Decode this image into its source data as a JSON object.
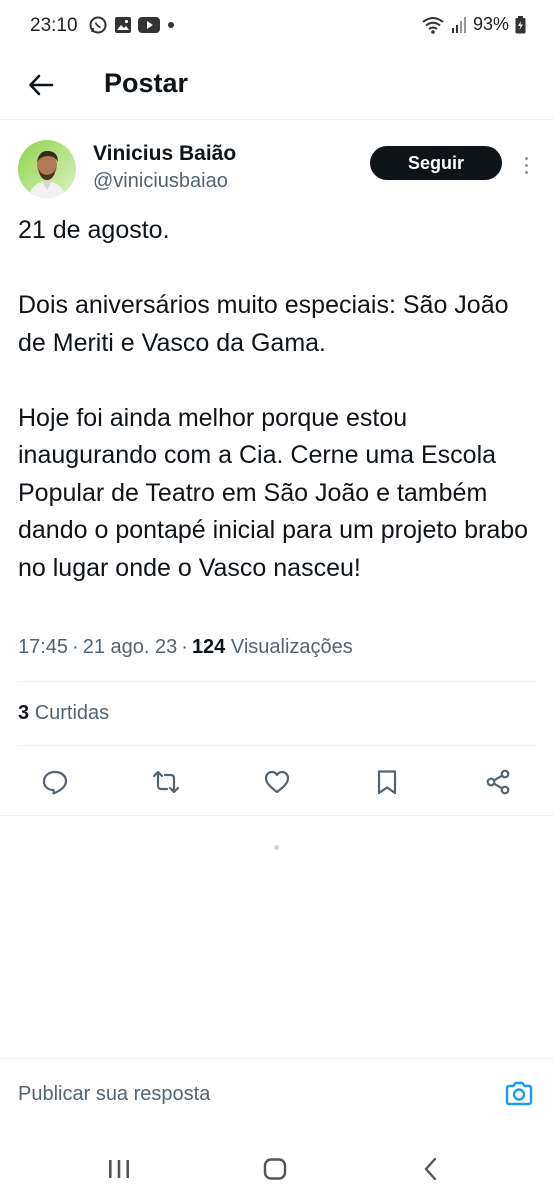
{
  "status_bar": {
    "time": "23:10",
    "battery": "93%",
    "left_icons": [
      "whatsapp-icon",
      "gallery-icon",
      "youtube-icon",
      "dot-icon"
    ],
    "right_icons": [
      "wifi-icon",
      "signal-icon",
      "battery-icon"
    ]
  },
  "header": {
    "title": "Postar",
    "back_icon": "arrow-left-icon"
  },
  "author": {
    "name": "Vinicius Baião",
    "handle": "@viniciusbaiao",
    "follow_label": "Seguir"
  },
  "tweet": {
    "paragraphs": [
      "21 de agosto.",
      "Dois aniversários muito especiais: São João de Meriti e Vasco da Gama.",
      "Hoje foi ainda melhor porque estou inaugurando com a Cia. Cerne uma Escola Popular de Teatro em São João e também dando o pontapé inicial para um projeto brabo no lugar onde o Vasco nasceu!"
    ],
    "time": "17:45",
    "date": "21 ago. 23",
    "views_count": "124",
    "views_label": "Visualizações",
    "likes_count": "3",
    "likes_label": "Curtidas"
  },
  "actions": [
    "reply-icon",
    "retweet-icon",
    "like-icon",
    "bookmark-icon",
    "share-icon"
  ],
  "reply": {
    "placeholder": "Publicar sua resposta",
    "camera_icon": "camera-icon"
  },
  "navigation": [
    "recents-icon",
    "home-icon",
    "back-icon"
  ],
  "colors": {
    "text": "#0f1419",
    "secondary": "#536471",
    "accent": "#1d9bf0",
    "follow_bg": "#0f1419",
    "divider": "#eff3f4"
  }
}
